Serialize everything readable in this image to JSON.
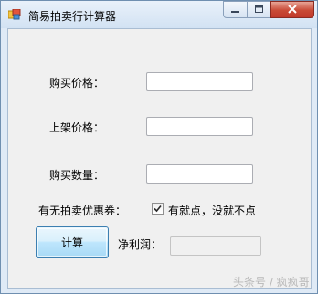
{
  "window": {
    "title": "简易拍卖行计算器"
  },
  "form": {
    "buy_price_label": "购买价格：",
    "list_price_label": "上架价格：",
    "quantity_label": "购买数量：",
    "coupon_label": "有无拍卖优惠券：",
    "coupon_checkbox_label": "有就点，没就不点",
    "coupon_checked": true,
    "buy_price_value": "",
    "list_price_value": "",
    "quantity_value": "",
    "net_profit_label": "净利润：",
    "net_profit_value": "",
    "calculate_button_label": "计算"
  },
  "watermark": "头条号 / 疯疯哥"
}
